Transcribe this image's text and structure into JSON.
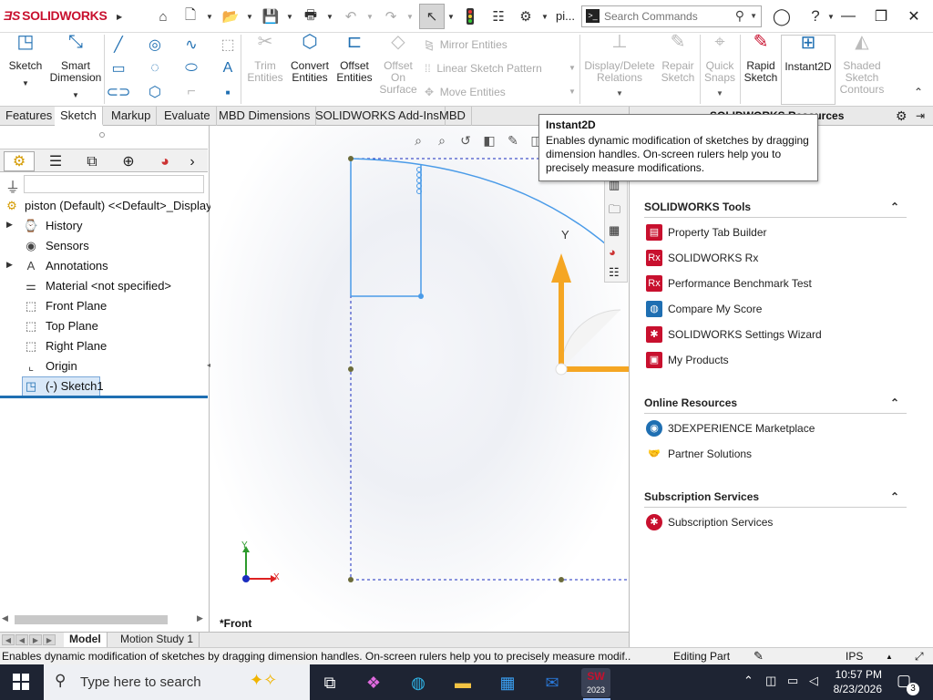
{
  "app": {
    "brand": "SOLIDWORKS",
    "doc_short": "pi...",
    "search_placeholder": "Search Commands",
    "accent": "#c8102e"
  },
  "command_manager": {
    "sketch": "Sketch",
    "smart_dimension": "Smart Dimension",
    "trim_entities": "Trim Entities",
    "convert_entities": "Convert Entities",
    "offset_entities": "Offset Entities",
    "offset_on_surface": "Offset On Surface",
    "mirror_entities": "Mirror Entities",
    "linear_sketch_pattern": "Linear Sketch Pattern",
    "move_entities": "Move Entities",
    "display_delete_relations": "Display/Delete Relations",
    "repair_sketch": "Repair Sketch",
    "quick_snaps": "Quick Snaps",
    "rapid_sketch": "Rapid Sketch",
    "instant2d": "Instant2D",
    "shaded_sketch_contours": "Shaded Sketch Contours"
  },
  "tabs": [
    "Features",
    "Sketch",
    "Markup",
    "Evaluate",
    "MBD Dimensions",
    "SOLIDWORKS Add-Ins",
    "MBD"
  ],
  "active_tab": "Sketch",
  "feature_tree": {
    "root": "piston (Default) <<Default>_Display S",
    "items": [
      {
        "label": "History",
        "icon": "history-folder-icon",
        "expandable": true
      },
      {
        "label": "Sensors",
        "icon": "sensors-icon",
        "expandable": false
      },
      {
        "label": "Annotations",
        "icon": "annotations-icon",
        "expandable": true
      },
      {
        "label": "Material <not specified>",
        "icon": "material-icon",
        "expandable": false
      },
      {
        "label": "Front Plane",
        "icon": "plane-icon",
        "expandable": false
      },
      {
        "label": "Top Plane",
        "icon": "plane-icon",
        "expandable": false
      },
      {
        "label": "Right Plane",
        "icon": "plane-icon",
        "expandable": false
      },
      {
        "label": "Origin",
        "icon": "origin-icon",
        "expandable": false
      },
      {
        "label": "(-) Sketch1",
        "icon": "sketch-icon",
        "expandable": false
      }
    ]
  },
  "viewport": {
    "view_name": "*Front",
    "axis_y": "Y",
    "triad_x": "X",
    "triad_y": "Y"
  },
  "tooltip": {
    "title": "Instant2D",
    "body": "Enables dynamic modification of sketches by dragging dimension handles. On-screen rulers help you to precisely measure modifications."
  },
  "task_pane": {
    "header": "SOLIDWORKS Resources",
    "sections": [
      {
        "title": "SOLIDWORKS Tools",
        "items": [
          {
            "label": "Property Tab Builder",
            "icon": "property-tab-builder-icon",
            "color": "#c8102e"
          },
          {
            "label": "SOLIDWORKS Rx",
            "icon": "solidworks-rx-icon",
            "color": "#c8102e"
          },
          {
            "label": "Performance Benchmark Test",
            "icon": "benchmark-icon",
            "color": "#c8102e"
          },
          {
            "label": "Compare My Score",
            "icon": "compare-score-icon",
            "color": "#1f6fb2"
          },
          {
            "label": "SOLIDWORKS Settings Wizard",
            "icon": "settings-wizard-icon",
            "color": "#c8102e"
          },
          {
            "label": "My Products",
            "icon": "my-products-icon",
            "color": "#c8102e"
          }
        ]
      },
      {
        "title": "Online Resources",
        "items": [
          {
            "label": "3DEXPERIENCE Marketplace",
            "icon": "marketplace-icon",
            "color": "#1f6fb2"
          },
          {
            "label": "Partner Solutions",
            "icon": "partner-solutions-icon",
            "color": "#777777"
          }
        ]
      },
      {
        "title": "Subscription Services",
        "items": [
          {
            "label": "Subscription Services",
            "icon": "subscription-icon",
            "color": "#c8102e"
          }
        ]
      }
    ]
  },
  "bottom_tabs": [
    "Model",
    "Motion Study 1"
  ],
  "status_bar": {
    "message": "Enables dynamic modification of sketches by dragging dimension handles. On-screen rulers help you to precisely measure modif...",
    "mode": "Editing Part",
    "units": "IPS"
  },
  "taskbar": {
    "search_placeholder": "Type here to search",
    "time": "10:57 PM",
    "date": "8/23/2026",
    "notifications": "3",
    "sw_badge": "2023"
  }
}
